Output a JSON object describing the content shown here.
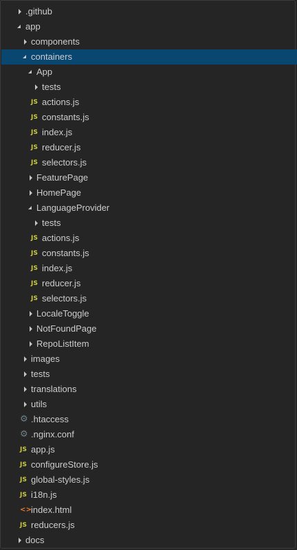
{
  "explorer": {
    "items": [
      {
        "label": ".github",
        "type": "folder",
        "depth": 0,
        "expanded": false,
        "icon": "chevron-right-icon"
      },
      {
        "label": "app",
        "type": "folder",
        "depth": 0,
        "expanded": true,
        "icon": "chevron-down-icon"
      },
      {
        "label": "components",
        "type": "folder",
        "depth": 1,
        "expanded": false,
        "icon": "chevron-right-icon"
      },
      {
        "label": "containers",
        "type": "folder",
        "depth": 1,
        "expanded": true,
        "selected": true,
        "icon": "chevron-down-icon"
      },
      {
        "label": "App",
        "type": "folder",
        "depth": 2,
        "expanded": true,
        "icon": "chevron-down-icon"
      },
      {
        "label": "tests",
        "type": "folder",
        "depth": 3,
        "expanded": false,
        "icon": "chevron-right-icon"
      },
      {
        "label": "actions.js",
        "type": "js",
        "depth": 3,
        "badge": "JS",
        "icon": "js-file-icon"
      },
      {
        "label": "constants.js",
        "type": "js",
        "depth": 3,
        "badge": "JS",
        "icon": "js-file-icon"
      },
      {
        "label": "index.js",
        "type": "js",
        "depth": 3,
        "badge": "JS",
        "icon": "js-file-icon"
      },
      {
        "label": "reducer.js",
        "type": "js",
        "depth": 3,
        "badge": "JS",
        "icon": "js-file-icon"
      },
      {
        "label": "selectors.js",
        "type": "js",
        "depth": 3,
        "badge": "JS",
        "icon": "js-file-icon"
      },
      {
        "label": "FeaturePage",
        "type": "folder",
        "depth": 2,
        "expanded": false,
        "icon": "chevron-right-icon"
      },
      {
        "label": "HomePage",
        "type": "folder",
        "depth": 2,
        "expanded": false,
        "icon": "chevron-right-icon"
      },
      {
        "label": "LanguageProvider",
        "type": "folder",
        "depth": 2,
        "expanded": true,
        "icon": "chevron-down-icon"
      },
      {
        "label": "tests",
        "type": "folder",
        "depth": 3,
        "expanded": false,
        "icon": "chevron-right-icon"
      },
      {
        "label": "actions.js",
        "type": "js",
        "depth": 3,
        "badge": "JS",
        "icon": "js-file-icon"
      },
      {
        "label": "constants.js",
        "type": "js",
        "depth": 3,
        "badge": "JS",
        "icon": "js-file-icon"
      },
      {
        "label": "index.js",
        "type": "js",
        "depth": 3,
        "badge": "JS",
        "icon": "js-file-icon"
      },
      {
        "label": "reducer.js",
        "type": "js",
        "depth": 3,
        "badge": "JS",
        "icon": "js-file-icon"
      },
      {
        "label": "selectors.js",
        "type": "js",
        "depth": 3,
        "badge": "JS",
        "icon": "js-file-icon"
      },
      {
        "label": "LocaleToggle",
        "type": "folder",
        "depth": 2,
        "expanded": false,
        "icon": "chevron-right-icon"
      },
      {
        "label": "NotFoundPage",
        "type": "folder",
        "depth": 2,
        "expanded": false,
        "icon": "chevron-right-icon"
      },
      {
        "label": "RepoListItem",
        "type": "folder",
        "depth": 2,
        "expanded": false,
        "icon": "chevron-right-icon"
      },
      {
        "label": "images",
        "type": "folder",
        "depth": 1,
        "expanded": false,
        "icon": "chevron-right-icon"
      },
      {
        "label": "tests",
        "type": "folder",
        "depth": 1,
        "expanded": false,
        "icon": "chevron-right-icon"
      },
      {
        "label": "translations",
        "type": "folder",
        "depth": 1,
        "expanded": false,
        "icon": "chevron-right-icon"
      },
      {
        "label": "utils",
        "type": "folder",
        "depth": 1,
        "expanded": false,
        "icon": "chevron-right-icon"
      },
      {
        "label": ".htaccess",
        "type": "config",
        "depth": 1,
        "badge": "⚙",
        "icon": "gear-icon"
      },
      {
        "label": ".nginx.conf",
        "type": "config",
        "depth": 1,
        "badge": "⚙",
        "icon": "gear-icon"
      },
      {
        "label": "app.js",
        "type": "js",
        "depth": 1,
        "badge": "JS",
        "icon": "js-file-icon"
      },
      {
        "label": "configureStore.js",
        "type": "js",
        "depth": 1,
        "badge": "JS",
        "icon": "js-file-icon"
      },
      {
        "label": "global-styles.js",
        "type": "js",
        "depth": 1,
        "badge": "JS",
        "icon": "js-file-icon"
      },
      {
        "label": "i18n.js",
        "type": "js",
        "depth": 1,
        "badge": "JS",
        "icon": "js-file-icon"
      },
      {
        "label": "index.html",
        "type": "html",
        "depth": 1,
        "badge": "<>",
        "icon": "html-file-icon"
      },
      {
        "label": "reducers.js",
        "type": "js",
        "depth": 1,
        "badge": "JS",
        "icon": "js-file-icon"
      },
      {
        "label": "docs",
        "type": "folder",
        "depth": 0,
        "expanded": false,
        "icon": "chevron-right-icon"
      }
    ]
  },
  "colors": {
    "background": "#252526",
    "selected": "#094771",
    "text": "#cccccc",
    "js_badge": "#cbcb41",
    "html_badge": "#e37933",
    "gear_badge": "#6d8086"
  }
}
